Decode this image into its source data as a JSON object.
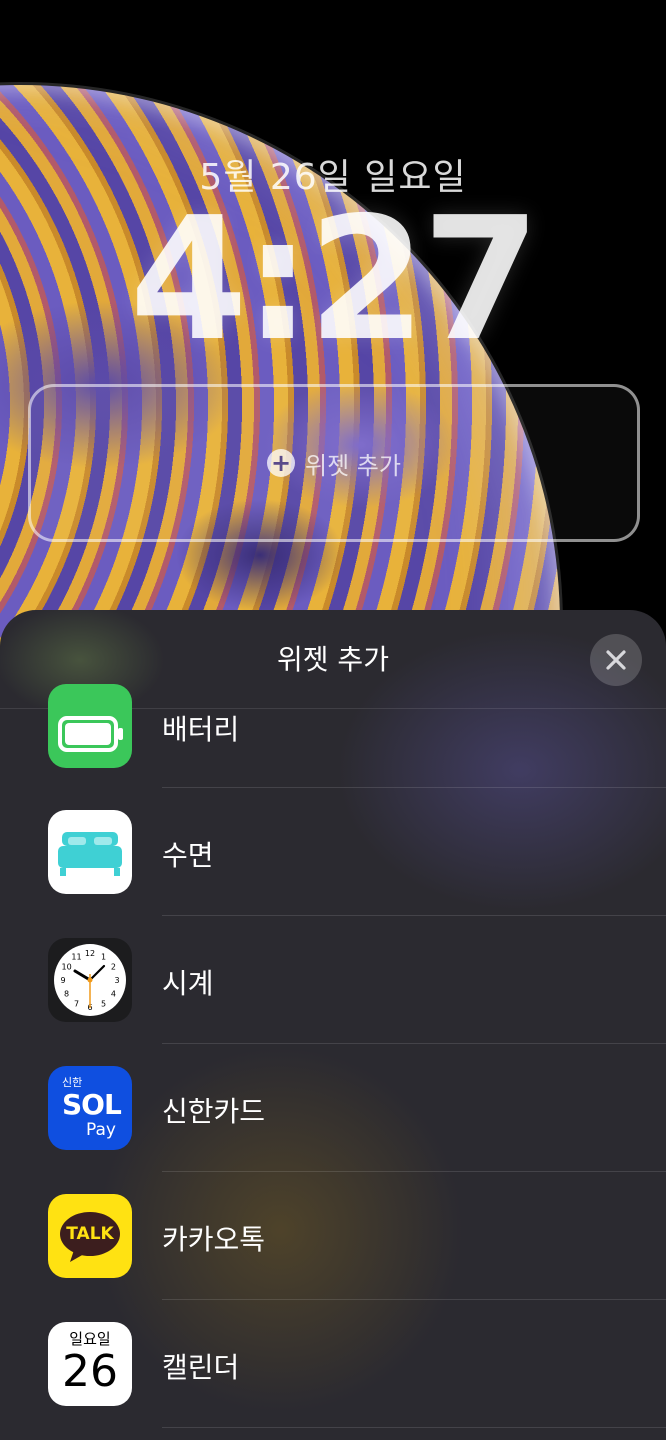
{
  "lock_screen": {
    "date": "5월 26일 일요일",
    "time": "4:27",
    "widget_slot_label": "위젯 추가"
  },
  "sheet": {
    "title": "위젯 추가",
    "items": [
      {
        "name": "배터리",
        "icon": "battery-icon"
      },
      {
        "name": "수면",
        "icon": "bed-icon"
      },
      {
        "name": "시계",
        "icon": "clock-icon"
      },
      {
        "name": "신한카드",
        "icon": "shinhan-sol-pay-icon",
        "icon_text": {
          "top": "신한",
          "mid": "SOL",
          "bot": "Pay"
        }
      },
      {
        "name": "카카오톡",
        "icon": "kakaotalk-icon",
        "icon_text": "TALK"
      },
      {
        "name": "캘린더",
        "icon": "calendar-icon",
        "icon_text": {
          "day": "일요일",
          "date": "26"
        }
      }
    ]
  },
  "colors": {
    "battery_green": "#3bc75a",
    "sleep_teal": "#3fd0d4",
    "shinhan_blue": "#0f4fe0",
    "kakao_yellow": "#ffe212",
    "kakao_brown": "#3c1e1e"
  },
  "clock_numbers": [
    "12",
    "1",
    "2",
    "3",
    "4",
    "5",
    "6",
    "7",
    "8",
    "9",
    "10",
    "11"
  ]
}
